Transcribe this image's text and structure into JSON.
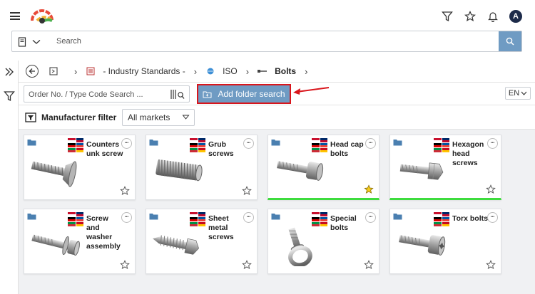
{
  "header": {
    "icons": [
      "hamburger-icon",
      "logo",
      "filter-icon",
      "star-icon",
      "bell-icon",
      "avatar"
    ],
    "avatar_initial": "A"
  },
  "search": {
    "placeholder": "Search"
  },
  "breadcrumb": {
    "items": [
      {
        "label": "- Industry Standards -"
      },
      {
        "label": "ISO"
      },
      {
        "label": "Bolts"
      }
    ]
  },
  "toolbar": {
    "order_placeholder": "Order No. / Type Code Search ...",
    "add_folder_label": "Add folder search",
    "language": "EN"
  },
  "filter": {
    "label": "Manufacturer filter",
    "markets_value": "All markets"
  },
  "colors": {
    "accent": "#6f9bc3",
    "highlight": "#d9161c",
    "green_bar": "#3ddc3d",
    "star_filled": "#f5cb1c"
  },
  "cards": [
    {
      "title": "Counters unk screw",
      "favorite": false,
      "highlighted": false
    },
    {
      "title": "Grub screws",
      "favorite": false,
      "highlighted": false
    },
    {
      "title": "Head cap bolts",
      "favorite": true,
      "highlighted": true
    },
    {
      "title": "Hexagon head screws",
      "favorite": false,
      "highlighted": true
    },
    {
      "title": "Screw and washer assembly",
      "favorite": false,
      "highlighted": false
    },
    {
      "title": "Sheet metal screws",
      "favorite": false,
      "highlighted": false
    },
    {
      "title": "Special bolts",
      "favorite": false,
      "highlighted": false
    },
    {
      "title": "Torx bolts",
      "favorite": false,
      "highlighted": false
    }
  ]
}
